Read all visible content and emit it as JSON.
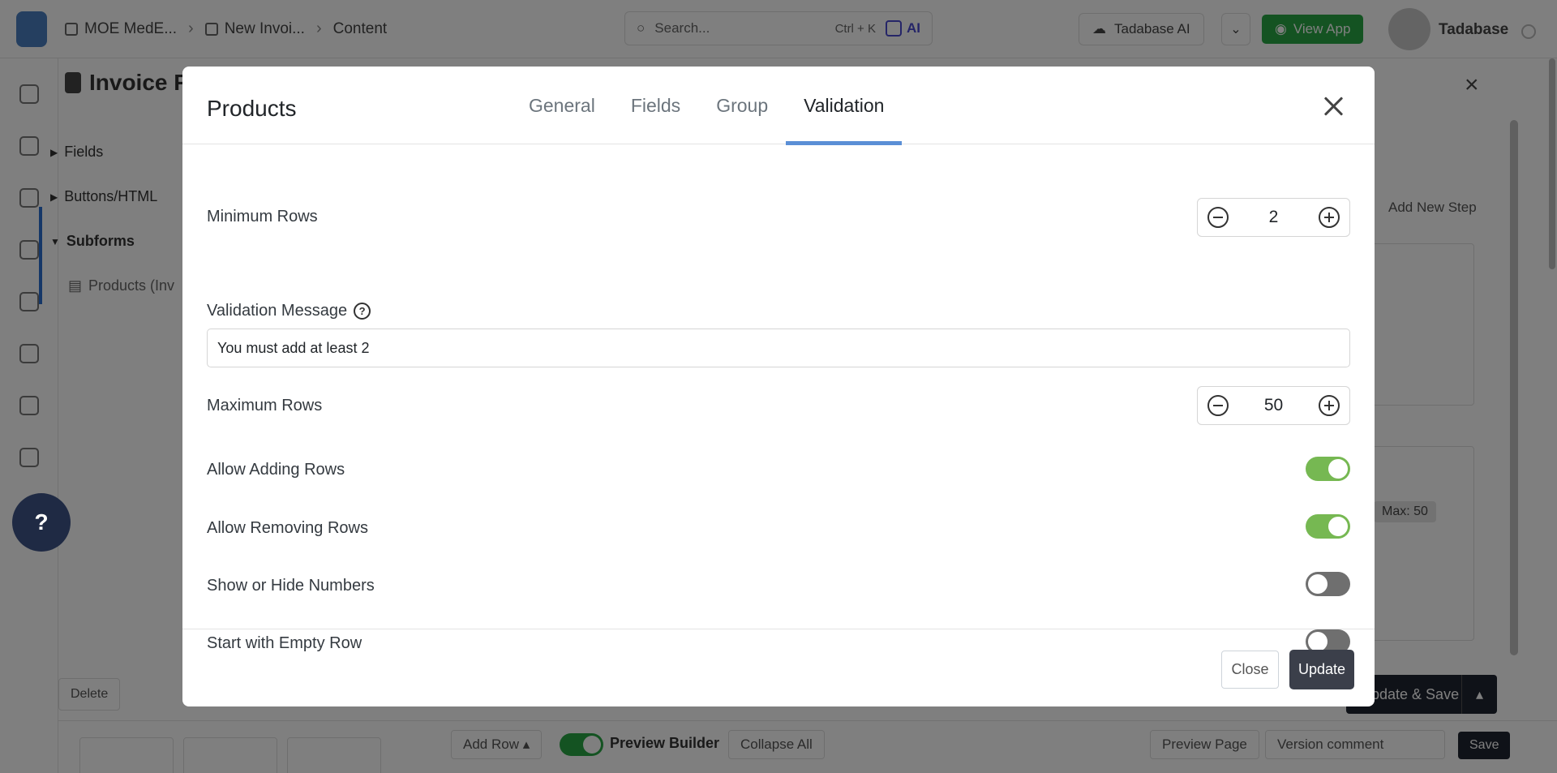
{
  "background": {
    "breadcrumbs": [
      "MOE MedE...",
      "New Invoi...",
      "Content"
    ],
    "search": {
      "placeholder": "Search...",
      "shortcut": "Ctrl + K",
      "ai_label": "AI"
    },
    "tadabase_ai_label": "Tadabase AI",
    "view_app_label": "View App",
    "user_name": "Tadabase",
    "panel_title": "Invoice Fo",
    "tree": {
      "fields_label": "Fields",
      "buttons_label": "Buttons/HTML",
      "subforms_label": "Subforms",
      "products_label": "Products (Inv"
    },
    "add_new_step_label": "Add New Step",
    "max_badge_label": "Max: 50",
    "delete_label": "Delete",
    "update_save_label": "Update & Save",
    "bottom": {
      "add_row_label": "Add Row",
      "preview_builder_label": "Preview Builder",
      "collapse_all_label": "Collapse All",
      "preview_page_label": "Preview Page",
      "version_comment_placeholder": "Version comment",
      "save_label": "Save"
    },
    "help_label": "?"
  },
  "modal": {
    "title": "Products",
    "tabs": [
      {
        "label": "General",
        "active": false
      },
      {
        "label": "Fields",
        "active": false
      },
      {
        "label": "Group",
        "active": false
      },
      {
        "label": "Validation",
        "active": true
      }
    ],
    "minimum_rows": {
      "label": "Minimum Rows",
      "value": "2"
    },
    "validation_message": {
      "label": "Validation Message",
      "value": "You must add at least 2"
    },
    "maximum_rows": {
      "label": "Maximum Rows",
      "value": "50"
    },
    "toggles": [
      {
        "label": "Allow Adding Rows",
        "on": true
      },
      {
        "label": "Allow Removing Rows",
        "on": true
      },
      {
        "label": "Show or Hide Numbers",
        "on": false
      },
      {
        "label": "Start with Empty Row",
        "on": false
      }
    ],
    "footer": {
      "close_label": "Close",
      "update_label": "Update"
    }
  },
  "colors": {
    "toggle_on": "#76b852",
    "toggle_off": "#6f6f6f",
    "tab_active_underline": "#5b8fd6",
    "update_button": "#3b3f4a",
    "view_app_green": "#28a745"
  }
}
